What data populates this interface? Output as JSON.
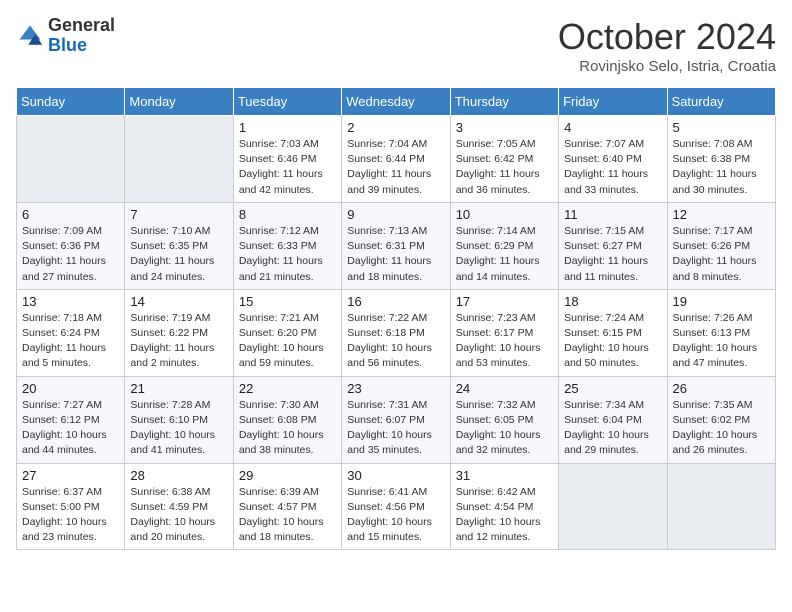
{
  "logo": {
    "general": "General",
    "blue": "Blue"
  },
  "header": {
    "month": "October 2024",
    "location": "Rovinjsko Selo, Istria, Croatia"
  },
  "weekdays": [
    "Sunday",
    "Monday",
    "Tuesday",
    "Wednesday",
    "Thursday",
    "Friday",
    "Saturday"
  ],
  "weeks": [
    [
      {
        "day": "",
        "sunrise": "",
        "sunset": "",
        "daylight": ""
      },
      {
        "day": "",
        "sunrise": "",
        "sunset": "",
        "daylight": ""
      },
      {
        "day": "1",
        "sunrise": "Sunrise: 7:03 AM",
        "sunset": "Sunset: 6:46 PM",
        "daylight": "Daylight: 11 hours and 42 minutes."
      },
      {
        "day": "2",
        "sunrise": "Sunrise: 7:04 AM",
        "sunset": "Sunset: 6:44 PM",
        "daylight": "Daylight: 11 hours and 39 minutes."
      },
      {
        "day": "3",
        "sunrise": "Sunrise: 7:05 AM",
        "sunset": "Sunset: 6:42 PM",
        "daylight": "Daylight: 11 hours and 36 minutes."
      },
      {
        "day": "4",
        "sunrise": "Sunrise: 7:07 AM",
        "sunset": "Sunset: 6:40 PM",
        "daylight": "Daylight: 11 hours and 33 minutes."
      },
      {
        "day": "5",
        "sunrise": "Sunrise: 7:08 AM",
        "sunset": "Sunset: 6:38 PM",
        "daylight": "Daylight: 11 hours and 30 minutes."
      }
    ],
    [
      {
        "day": "6",
        "sunrise": "Sunrise: 7:09 AM",
        "sunset": "Sunset: 6:36 PM",
        "daylight": "Daylight: 11 hours and 27 minutes."
      },
      {
        "day": "7",
        "sunrise": "Sunrise: 7:10 AM",
        "sunset": "Sunset: 6:35 PM",
        "daylight": "Daylight: 11 hours and 24 minutes."
      },
      {
        "day": "8",
        "sunrise": "Sunrise: 7:12 AM",
        "sunset": "Sunset: 6:33 PM",
        "daylight": "Daylight: 11 hours and 21 minutes."
      },
      {
        "day": "9",
        "sunrise": "Sunrise: 7:13 AM",
        "sunset": "Sunset: 6:31 PM",
        "daylight": "Daylight: 11 hours and 18 minutes."
      },
      {
        "day": "10",
        "sunrise": "Sunrise: 7:14 AM",
        "sunset": "Sunset: 6:29 PM",
        "daylight": "Daylight: 11 hours and 14 minutes."
      },
      {
        "day": "11",
        "sunrise": "Sunrise: 7:15 AM",
        "sunset": "Sunset: 6:27 PM",
        "daylight": "Daylight: 11 hours and 11 minutes."
      },
      {
        "day": "12",
        "sunrise": "Sunrise: 7:17 AM",
        "sunset": "Sunset: 6:26 PM",
        "daylight": "Daylight: 11 hours and 8 minutes."
      }
    ],
    [
      {
        "day": "13",
        "sunrise": "Sunrise: 7:18 AM",
        "sunset": "Sunset: 6:24 PM",
        "daylight": "Daylight: 11 hours and 5 minutes."
      },
      {
        "day": "14",
        "sunrise": "Sunrise: 7:19 AM",
        "sunset": "Sunset: 6:22 PM",
        "daylight": "Daylight: 11 hours and 2 minutes."
      },
      {
        "day": "15",
        "sunrise": "Sunrise: 7:21 AM",
        "sunset": "Sunset: 6:20 PM",
        "daylight": "Daylight: 10 hours and 59 minutes."
      },
      {
        "day": "16",
        "sunrise": "Sunrise: 7:22 AM",
        "sunset": "Sunset: 6:18 PM",
        "daylight": "Daylight: 10 hours and 56 minutes."
      },
      {
        "day": "17",
        "sunrise": "Sunrise: 7:23 AM",
        "sunset": "Sunset: 6:17 PM",
        "daylight": "Daylight: 10 hours and 53 minutes."
      },
      {
        "day": "18",
        "sunrise": "Sunrise: 7:24 AM",
        "sunset": "Sunset: 6:15 PM",
        "daylight": "Daylight: 10 hours and 50 minutes."
      },
      {
        "day": "19",
        "sunrise": "Sunrise: 7:26 AM",
        "sunset": "Sunset: 6:13 PM",
        "daylight": "Daylight: 10 hours and 47 minutes."
      }
    ],
    [
      {
        "day": "20",
        "sunrise": "Sunrise: 7:27 AM",
        "sunset": "Sunset: 6:12 PM",
        "daylight": "Daylight: 10 hours and 44 minutes."
      },
      {
        "day": "21",
        "sunrise": "Sunrise: 7:28 AM",
        "sunset": "Sunset: 6:10 PM",
        "daylight": "Daylight: 10 hours and 41 minutes."
      },
      {
        "day": "22",
        "sunrise": "Sunrise: 7:30 AM",
        "sunset": "Sunset: 6:08 PM",
        "daylight": "Daylight: 10 hours and 38 minutes."
      },
      {
        "day": "23",
        "sunrise": "Sunrise: 7:31 AM",
        "sunset": "Sunset: 6:07 PM",
        "daylight": "Daylight: 10 hours and 35 minutes."
      },
      {
        "day": "24",
        "sunrise": "Sunrise: 7:32 AM",
        "sunset": "Sunset: 6:05 PM",
        "daylight": "Daylight: 10 hours and 32 minutes."
      },
      {
        "day": "25",
        "sunrise": "Sunrise: 7:34 AM",
        "sunset": "Sunset: 6:04 PM",
        "daylight": "Daylight: 10 hours and 29 minutes."
      },
      {
        "day": "26",
        "sunrise": "Sunrise: 7:35 AM",
        "sunset": "Sunset: 6:02 PM",
        "daylight": "Daylight: 10 hours and 26 minutes."
      }
    ],
    [
      {
        "day": "27",
        "sunrise": "Sunrise: 6:37 AM",
        "sunset": "Sunset: 5:00 PM",
        "daylight": "Daylight: 10 hours and 23 minutes."
      },
      {
        "day": "28",
        "sunrise": "Sunrise: 6:38 AM",
        "sunset": "Sunset: 4:59 PM",
        "daylight": "Daylight: 10 hours and 20 minutes."
      },
      {
        "day": "29",
        "sunrise": "Sunrise: 6:39 AM",
        "sunset": "Sunset: 4:57 PM",
        "daylight": "Daylight: 10 hours and 18 minutes."
      },
      {
        "day": "30",
        "sunrise": "Sunrise: 6:41 AM",
        "sunset": "Sunset: 4:56 PM",
        "daylight": "Daylight: 10 hours and 15 minutes."
      },
      {
        "day": "31",
        "sunrise": "Sunrise: 6:42 AM",
        "sunset": "Sunset: 4:54 PM",
        "daylight": "Daylight: 10 hours and 12 minutes."
      },
      {
        "day": "",
        "sunrise": "",
        "sunset": "",
        "daylight": ""
      },
      {
        "day": "",
        "sunrise": "",
        "sunset": "",
        "daylight": ""
      }
    ]
  ]
}
